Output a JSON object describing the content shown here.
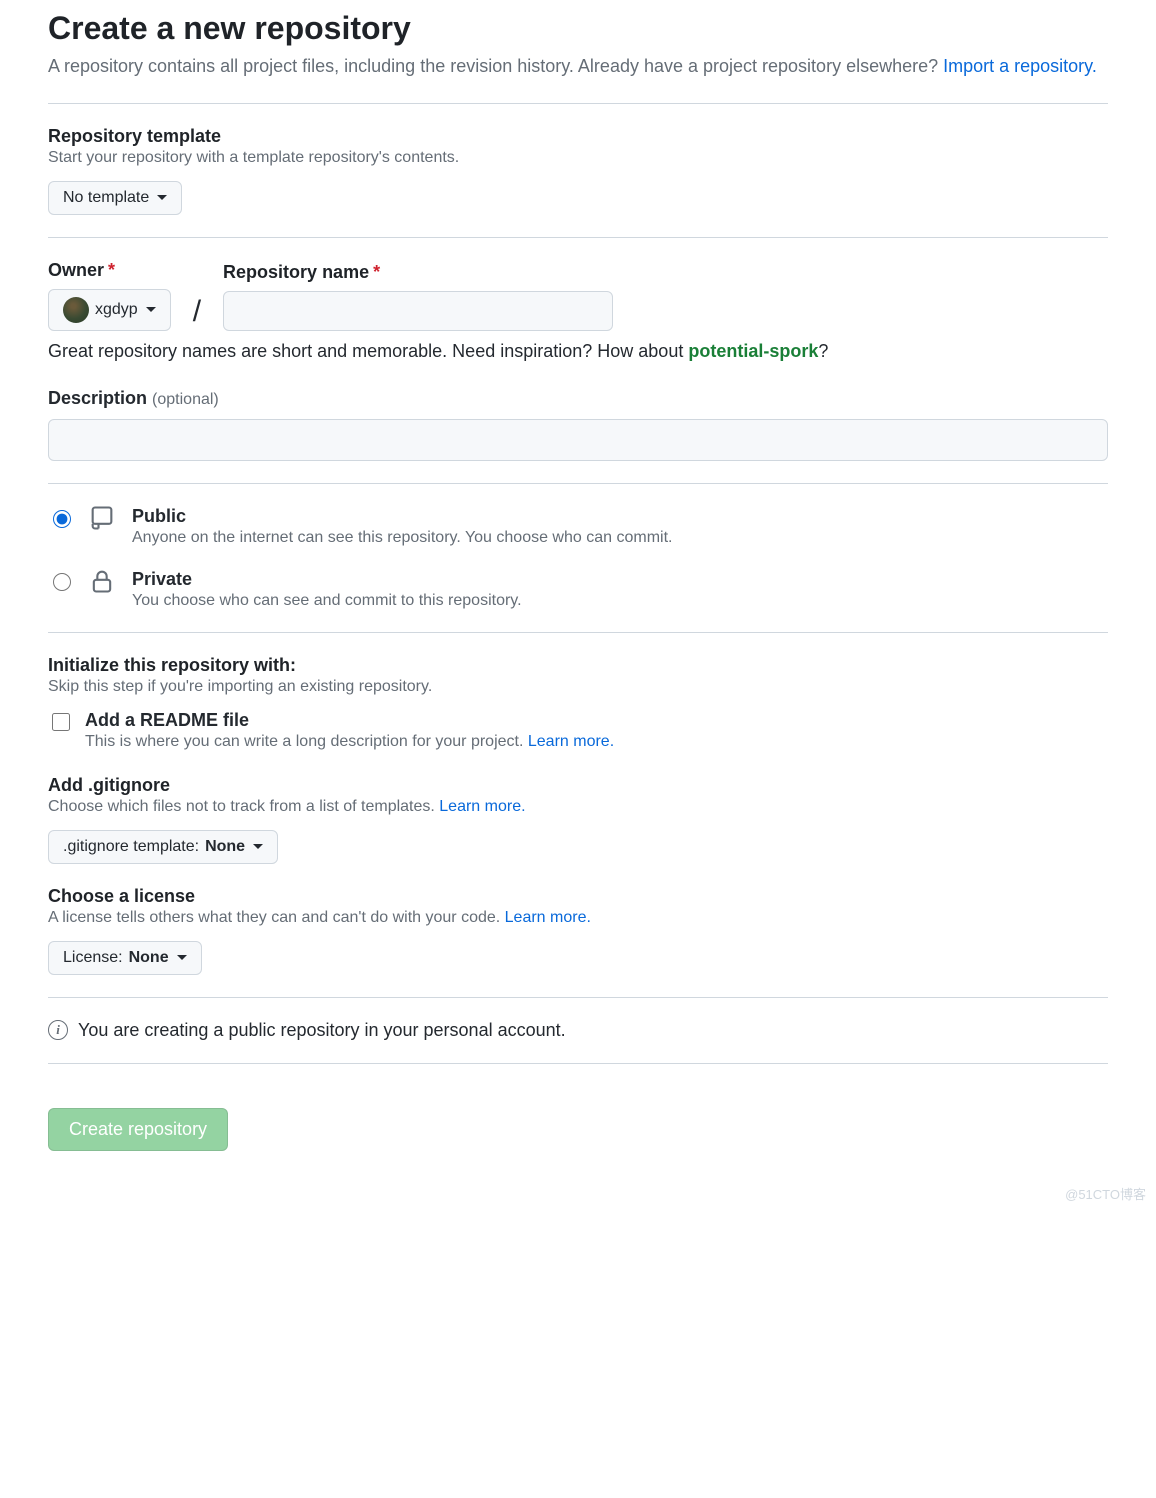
{
  "header": {
    "title": "Create a new repository",
    "subtitle_a": "A repository contains all project files, including the revision history. Already have a project repository elsewhere? ",
    "import_link": "Import a repository."
  },
  "template": {
    "label": "Repository template",
    "help": "Start your repository with a template repository's contents.",
    "button_label": "No template"
  },
  "owner": {
    "label": "Owner",
    "name": "xgdyp"
  },
  "repo": {
    "label": "Repository name",
    "value": ""
  },
  "inspiration": {
    "prefix": "Great repository names are short and memorable. Need inspiration? How about ",
    "suggestion": "potential-spork",
    "suffix": "?"
  },
  "description": {
    "label": "Description",
    "optional": "(optional)",
    "value": ""
  },
  "visibility": {
    "public": {
      "title": "Public",
      "desc": "Anyone on the internet can see this repository. You choose who can commit."
    },
    "private": {
      "title": "Private",
      "desc": "You choose who can see and commit to this repository."
    }
  },
  "init": {
    "heading": "Initialize this repository with:",
    "skip": "Skip this step if you're importing an existing repository.",
    "readme": {
      "title": "Add a README file",
      "desc_a": "This is where you can write a long description for your project. ",
      "learn": "Learn more."
    },
    "gitignore": {
      "heading": "Add .gitignore",
      "help_a": "Choose which files not to track from a list of templates. ",
      "learn": "Learn more.",
      "btn_prefix": ".gitignore template: ",
      "btn_value": "None"
    },
    "license": {
      "heading": "Choose a license",
      "help_a": "A license tells others what they can and can't do with your code. ",
      "learn": "Learn more.",
      "btn_prefix": "License: ",
      "btn_value": "None"
    }
  },
  "info_line": "You are creating a public repository in your personal account.",
  "submit": "Create repository",
  "watermark": "@51CTO博客"
}
